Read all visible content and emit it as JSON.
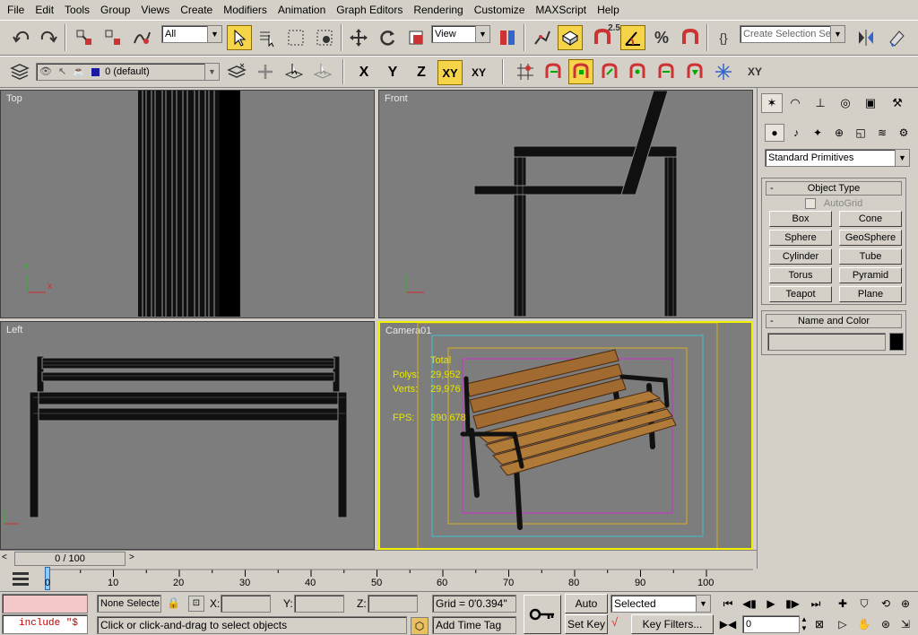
{
  "menu": [
    "File",
    "Edit",
    "Tools",
    "Group",
    "Views",
    "Create",
    "Modifiers",
    "Animation",
    "Graph Editors",
    "Rendering",
    "Customize",
    "MAXScript",
    "Help"
  ],
  "toolbar1": {
    "selection_filter": "All",
    "reference_coord": "View",
    "named_selection_placeholder": "Create Selection Set",
    "snap_angle_label": "2.5"
  },
  "toolbar2": {
    "layer_name": "0 (default)",
    "axis_x": "X",
    "axis_y": "Y",
    "axis_z": "Z",
    "axis_xy": "XY",
    "axis_xy_alt": "XY"
  },
  "viewports": {
    "top_label": "Top",
    "front_label": "Front",
    "left_label": "Left",
    "camera_label": "Camera01",
    "axis_x": "x",
    "axis_y": "y",
    "stats": {
      "total_label": "Total",
      "polys_label": "Polys:",
      "polys_value": "29,952",
      "verts_label": "Verts:",
      "verts_value": "29,976",
      "fps_label": "FPS:",
      "fps_value": "390.678"
    }
  },
  "command_panel": {
    "category": "Standard Primitives",
    "object_type_title": "Object Type",
    "autogrid_label": "AutoGrid",
    "primitives": [
      "Box",
      "Cone",
      "Sphere",
      "GeoSphere",
      "Cylinder",
      "Tube",
      "Torus",
      "Pyramid",
      "Teapot",
      "Plane"
    ],
    "name_color_title": "Name and Color",
    "name_value": "",
    "object_color": "#000000"
  },
  "timeline": {
    "frame_readout": "0 / 100",
    "ruler": [
      "0",
      "10",
      "20",
      "30",
      "40",
      "50",
      "60",
      "70",
      "80",
      "90",
      "100"
    ]
  },
  "status": {
    "maxscript_listener": "include \"$",
    "selection_status": "None Selecte",
    "prompt": "Click or click-and-drag to select objects",
    "x_label": "X:",
    "y_label": "Y:",
    "z_label": "Z:",
    "x_value": "",
    "y_value": "",
    "z_value": "",
    "grid": "Grid = 0'0.394\"",
    "add_time_tag": "Add Time Tag",
    "auto_key": "Auto Key",
    "set_key": "Set Key",
    "key_mode": "Selected",
    "key_filters": "Key Filters...",
    "current_frame": "0"
  }
}
